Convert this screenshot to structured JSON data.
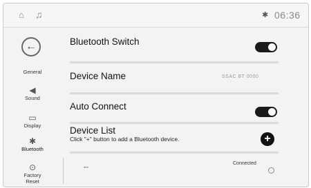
{
  "statusbar": {
    "home_icon": "⌂",
    "music_icon": "♫",
    "bt_icon": "✱",
    "time": "06:36"
  },
  "sidebar": {
    "back_icon": "←",
    "items": [
      {
        "label": "General",
        "icon": ""
      },
      {
        "label": "Sound",
        "icon": "◀"
      },
      {
        "label": "Display",
        "icon": "▭"
      },
      {
        "label": "Bluetooth",
        "icon": "✱"
      },
      {
        "label": "Factory Reset",
        "icon": "⊙"
      }
    ]
  },
  "settings": {
    "bluetooth_switch": {
      "label": "Bluetooth Switch",
      "on": true
    },
    "device_name": {
      "label": "Device Name",
      "value": "SSAC BT 0000"
    },
    "auto_connect": {
      "label": "Auto Connect",
      "on": true
    },
    "device_list": {
      "label": "Device List",
      "hint": "Click \"+\" button to add a Bluetooth device.",
      "add_label": "+"
    },
    "paired_device": {
      "name": "▪▪▪",
      "status": "Connected"
    }
  }
}
